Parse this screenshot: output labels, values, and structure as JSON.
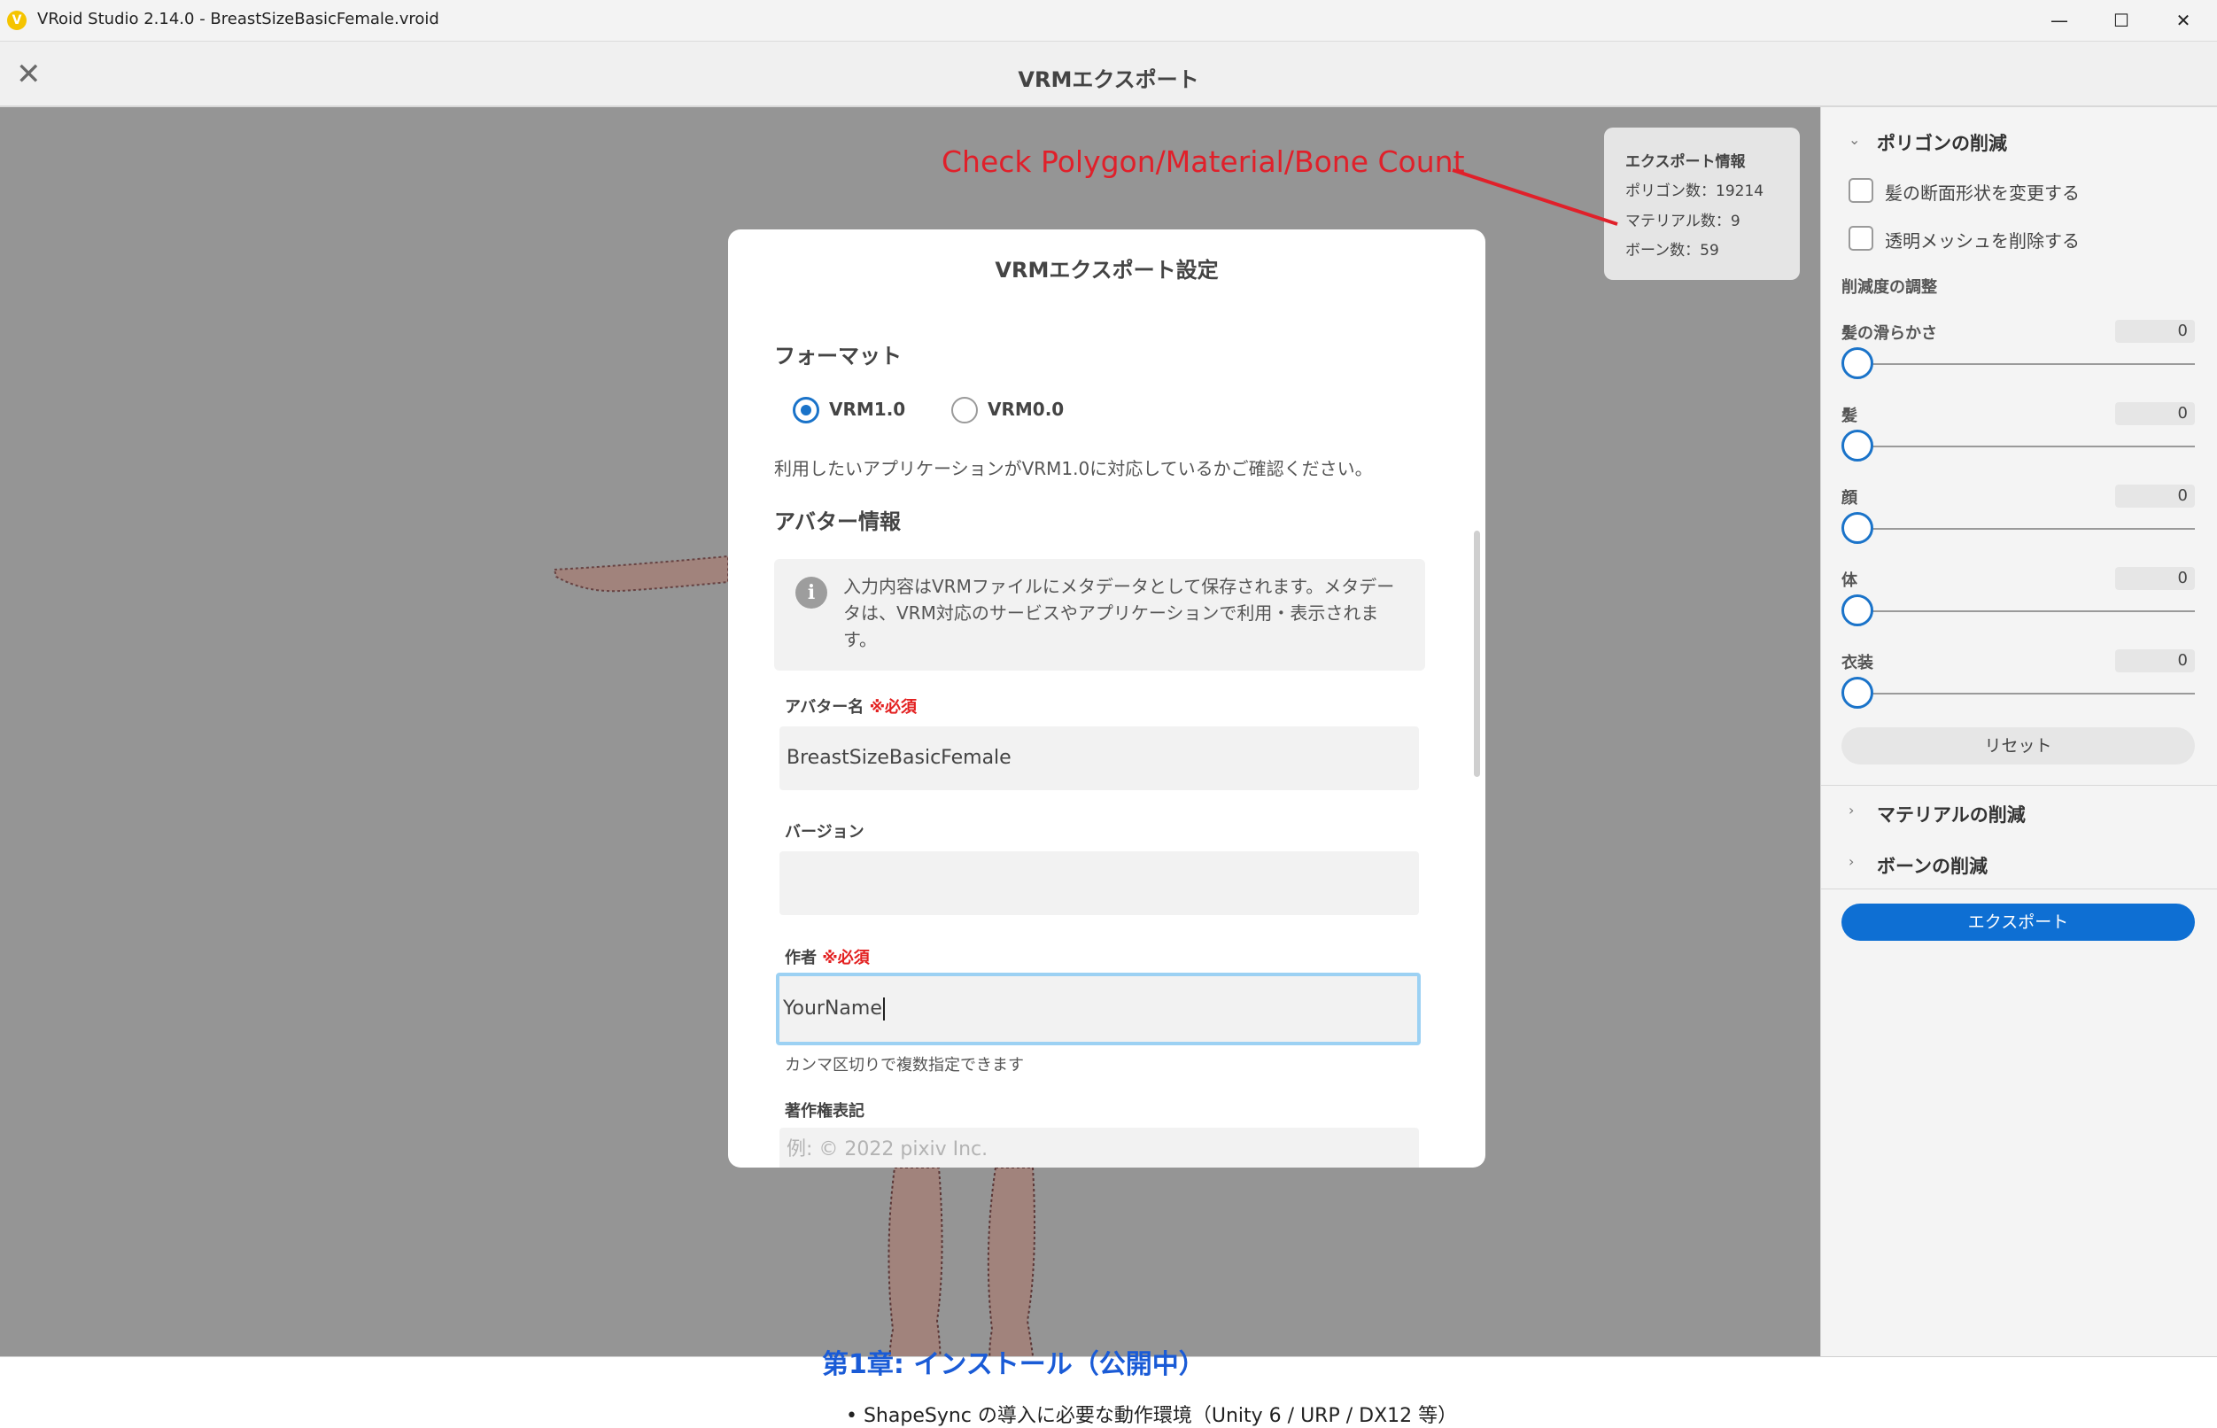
{
  "window": {
    "title": "VRoid Studio 2.14.0 - BreastSizeBasicFemale.vroid",
    "logo_letter": "V",
    "minimize_glyph": "—",
    "maximize_glyph": "☐",
    "close_glyph": "✕"
  },
  "header": {
    "title": "VRMエクスポート",
    "close_glyph": "✕"
  },
  "export_info": {
    "title": "エクスポート情報",
    "polygon": "ポリゴン数：19214",
    "material": "マテリアル数：9",
    "bone": "ボーン数：59"
  },
  "annotation": {
    "text": "Check Polygon/Material/Bone Count",
    "color": "#e0202a"
  },
  "right_panel": {
    "polygon_section": {
      "title": "ポリゴンの削減",
      "checkboxes": [
        {
          "label": "髪の断面形状を変更する",
          "checked": false
        },
        {
          "label": "透明メッシュを削除する",
          "checked": false
        }
      ],
      "adjust_title": "削減度の調整",
      "sliders": [
        {
          "label": "髪の滑らかさ",
          "value": "0"
        },
        {
          "label": "髪",
          "value": "0"
        },
        {
          "label": "顔",
          "value": "0"
        },
        {
          "label": "体",
          "value": "0"
        },
        {
          "label": "衣装",
          "value": "0"
        }
      ],
      "reset_label": "リセット"
    },
    "material_section_title": "マテリアルの削減",
    "bone_section_title": "ボーンの削減",
    "export_label": "エクスポート",
    "accent": "#0e6fd3"
  },
  "modal": {
    "title": "VRMエクスポート設定",
    "format_title": "フォーマット",
    "format_options": [
      {
        "label": "VRM1.0",
        "selected": true
      },
      {
        "label": "VRM0.0",
        "selected": false
      }
    ],
    "format_note": "利用したいアプリケーションがVRM1.0に対応しているかご確認ください。",
    "avatar_info_title": "アバター情報",
    "info_icon": "i",
    "info_text": "入力内容はVRMファイルにメタデータとして保存されます。メタデータは、VRM対応のサービスやアプリケーションで利用・表示されます。",
    "required_mark": "※必須",
    "fields": {
      "avatar_name": {
        "label": "アバター名",
        "value": "BreastSizeBasicFemale"
      },
      "version": {
        "label": "バージョン",
        "value": ""
      },
      "author": {
        "label": "作者",
        "value": "YourName",
        "hint": "カンマ区切りで複数指定できます"
      },
      "copyright": {
        "label": "著作権表記",
        "placeholder": "例: ©      2022 pixiv Inc."
      }
    }
  },
  "background_doc": {
    "heading": "第1章: インストール（公開中）",
    "bullet": "• ShapeSync の導入に必要な動作環境（Unity 6 / URP / DX12 等）"
  }
}
